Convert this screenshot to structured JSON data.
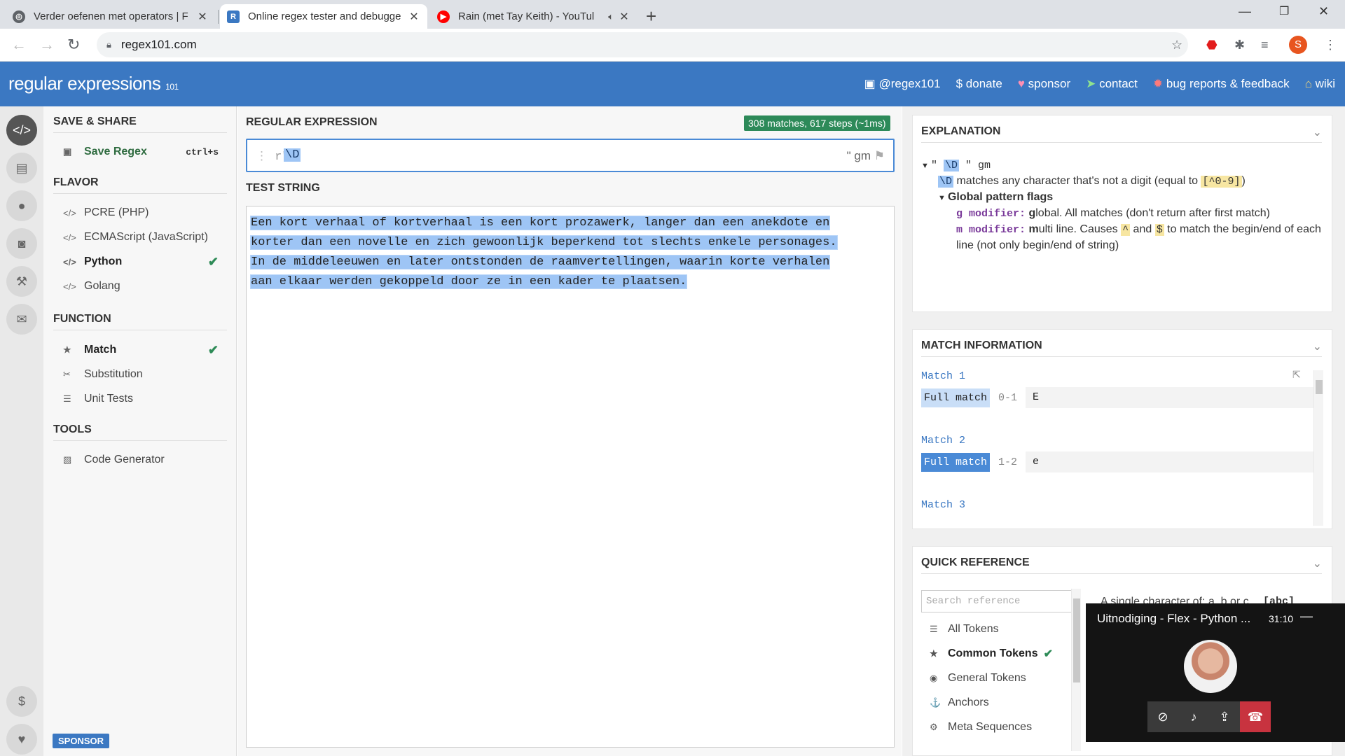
{
  "browser": {
    "tabs": [
      {
        "title": "Verder oefenen met operators | F",
        "favicon_color": "#5f6368"
      },
      {
        "title": "Online regex tester and debugge",
        "favicon_color": "#3b78c2",
        "favicon_letter": "R"
      },
      {
        "title": "Rain (met Tay Keith) - YouTul",
        "favicon_color": "#ff0000"
      }
    ],
    "url": "regex101.com",
    "profile_initial": "S"
  },
  "header": {
    "logo_a": "regular",
    "logo_b": " expressions",
    "logo_ver": "101",
    "links": [
      {
        "icon": "twitter-icon",
        "label": "@regex101"
      },
      {
        "icon": "dollar-icon",
        "label": "$ donate"
      },
      {
        "icon": "heart-icon",
        "label": "sponsor"
      },
      {
        "icon": "send-icon",
        "label": "contact"
      },
      {
        "icon": "bug-icon",
        "label": "bug reports & feedback"
      },
      {
        "icon": "wiki-icon",
        "label": "wiki"
      }
    ]
  },
  "sidebar": {
    "save_share_title": "SAVE & SHARE",
    "save_label": "Save Regex",
    "save_shortcut": "ctrl+s",
    "flavor_title": "FLAVOR",
    "flavors": [
      "PCRE (PHP)",
      "ECMAScript (JavaScript)",
      "Python",
      "Golang"
    ],
    "selected_flavor": "Python",
    "function_title": "FUNCTION",
    "functions": [
      "Match",
      "Substitution",
      "Unit Tests"
    ],
    "tools_title": "TOOLS",
    "tools": [
      "Code Generator"
    ],
    "sponsor_label": "SPONSOR"
  },
  "main": {
    "regex_title": "REGULAR EXPRESSION",
    "match_info": "308 matches, 617 steps (~1ms)",
    "regex_prefix": "r\"",
    "regex": "\\D",
    "regex_suffix": "\" gm",
    "test_title": "TEST STRING",
    "test_lines": [
      "Een kort verhaal of kortverhaal is een kort prozawerk, langer dan een anekdote en",
      "korter dan een novelle en zich gewoonlijk beperkend tot slechts enkele personages.",
      "In de middeleeuwen en later ontstonden de raamvertellingen, waarin korte verhalen",
      "aan elkaar werden gekoppeld door ze in een kader te plaatsen."
    ]
  },
  "explanation": {
    "title": "EXPLANATION",
    "regex_line_pre": "\" ",
    "regex_token": "\\D",
    "regex_line_post": " \" gm",
    "desc_token": "\\D",
    "desc_text": " matches any character that's not a digit (equal to ",
    "desc_class": "[^0-9]",
    "desc_end": ")",
    "flags_title": "Global pattern flags",
    "g_mod": "g modifier:",
    "g_text_bold": " g",
    "g_text": "lobal. All matches (don't return after first match)",
    "m_mod": "m modifier:",
    "m_text_bold": " m",
    "m_text": "ulti line. Causes ",
    "caret": "^",
    "and": " and ",
    "dollar": "$",
    "m_text2": " to match the begin/end of each line (not only begin/end of string)"
  },
  "match_information": {
    "title": "MATCH INFORMATION",
    "matches": [
      {
        "label": "Match 1",
        "kind": "Full match",
        "range": "0-1",
        "value": "E"
      },
      {
        "label": "Match 2",
        "kind": "Full match",
        "range": "1-2",
        "value": "e"
      },
      {
        "label": "Match 3"
      }
    ]
  },
  "quick_reference": {
    "title": "QUICK REFERENCE",
    "search_placeholder": "Search reference",
    "items": [
      {
        "icon": "list-icon",
        "label": "All Tokens"
      },
      {
        "icon": "star-icon",
        "label": "Common Tokens"
      },
      {
        "icon": "target-icon",
        "label": "General Tokens"
      },
      {
        "icon": "anchor-icon",
        "label": "Anchors"
      },
      {
        "icon": "gear-icon",
        "label": "Meta Sequences"
      }
    ],
    "selected": "Common Tokens",
    "desc": "A single character of: a, b or c",
    "token": "[abc]"
  },
  "call": {
    "title": "Uitnodiging - Flex - Python ...",
    "time": "31:10"
  }
}
